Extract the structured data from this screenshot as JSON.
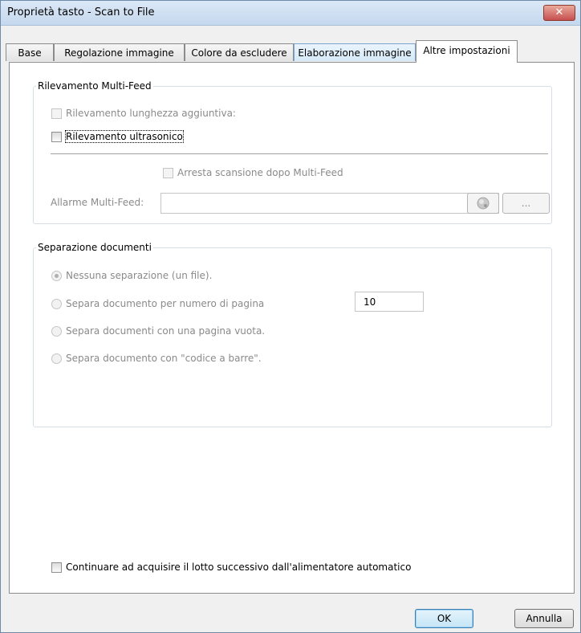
{
  "window": {
    "title": "Proprietà tasto - Scan to File",
    "close_icon": "close-icon"
  },
  "tabs": [
    {
      "label": "Base"
    },
    {
      "label": "Regolazione immagine"
    },
    {
      "label": "Colore da escludere"
    },
    {
      "label": "Elaborazione immagine"
    },
    {
      "label": "Altre impostazioni"
    }
  ],
  "active_tab": "Altre impostazioni",
  "multifeed": {
    "legend": "Rilevamento Multi-Feed",
    "length_detection_label": "Rilevamento lunghezza aggiuntiva:",
    "length_detection_checked": false,
    "length_detection_enabled": false,
    "ultrasonic_label": "Rilevamento ultrasonico",
    "ultrasonic_checked": false,
    "stop_scan_label": "Arresta scansione dopo Multi-Feed",
    "stop_scan_checked": false,
    "alarm_label": "Allarme Multi-Feed:",
    "alarm_value": "",
    "play_icon": "speaker-icon",
    "browse_label": "..."
  },
  "separation": {
    "legend": "Separazione documenti",
    "options": [
      {
        "label": "Nessuna separazione (un file).",
        "selected": true
      },
      {
        "label": "Separa documento per numero di pagina",
        "selected": false
      },
      {
        "label": "Separa documenti con una pagina vuota.",
        "selected": false
      },
      {
        "label": "Separa documento con \"codice a barre\".",
        "selected": false
      }
    ],
    "page_count_value": "10"
  },
  "continue_batch": {
    "label": "Continuare ad acquisire il lotto successivo dall'alimentatore automatico",
    "checked": false
  },
  "buttons": {
    "ok": "OK",
    "cancel": "Annulla"
  }
}
